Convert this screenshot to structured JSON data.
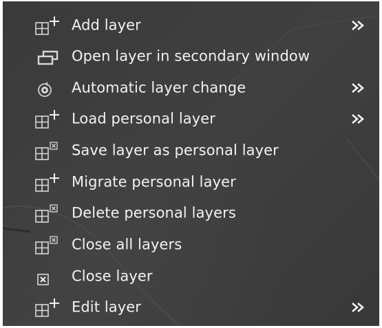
{
  "menu": {
    "items": [
      {
        "label": "Add layer",
        "icon": "add-layer-icon",
        "submenu": true
      },
      {
        "label": "Open layer in secondary window",
        "icon": "secondary-window-icon",
        "submenu": false
      },
      {
        "label": "Automatic layer change",
        "icon": "automatic-change-icon",
        "submenu": true
      },
      {
        "label": "Load personal layer",
        "icon": "add-layer-icon",
        "submenu": true
      },
      {
        "label": "Save layer as personal layer",
        "icon": "layer-x-icon",
        "submenu": false
      },
      {
        "label": "Migrate personal layer",
        "icon": "add-layer-icon",
        "submenu": false
      },
      {
        "label": "Delete personal layers",
        "icon": "layer-x-icon",
        "submenu": false
      },
      {
        "label": "Close all layers",
        "icon": "layer-x-icon",
        "submenu": false
      },
      {
        "label": "Close layer",
        "icon": "close-box-icon",
        "submenu": false
      },
      {
        "label": "Edit layer",
        "icon": "add-layer-icon",
        "submenu": true
      }
    ]
  },
  "colors": {
    "background": "#3c3c3c",
    "text": "#f2f2f2",
    "icon": "#d8d8d8"
  }
}
